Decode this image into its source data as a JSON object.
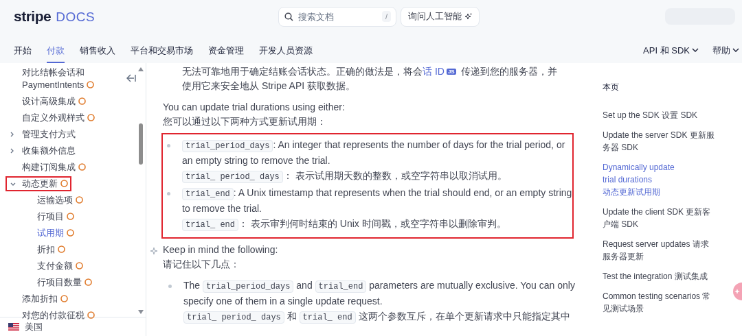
{
  "header": {
    "logo": {
      "wordmark": "stripe",
      "product": "DOCS"
    },
    "search": {
      "placeholder": "搜索文档",
      "shortcut": "/"
    },
    "ask_ai": {
      "label": "询问人工智能"
    },
    "nav": [
      {
        "label": "开始",
        "selected": false
      },
      {
        "label": "付款",
        "selected": true
      },
      {
        "label": "销售收入",
        "selected": false
      },
      {
        "label": "平台和交易市场",
        "selected": false
      },
      {
        "label": "资金管理",
        "selected": false
      },
      {
        "label": "开发人员资源",
        "selected": false
      }
    ],
    "menus": [
      "API 和 SDK",
      "帮助"
    ]
  },
  "sidebar": {
    "items": [
      {
        "label": "对比结帐会话和 PaymentIntents",
        "kind": "link",
        "marked": true,
        "selected": false
      },
      {
        "label": "设计高级集成",
        "kind": "link",
        "marked": true,
        "selected": false
      },
      {
        "label": "自定义外观样式",
        "kind": "link",
        "marked": true,
        "selected": false
      },
      {
        "label": "管理支付方式",
        "kind": "group",
        "expanded": false,
        "marked": false,
        "selected": false
      },
      {
        "label": "收集额外信息",
        "kind": "group",
        "expanded": false,
        "marked": false,
        "selected": false
      },
      {
        "label": "构建订阅集成",
        "kind": "link",
        "marked": true,
        "selected": false
      },
      {
        "label": "动态更新",
        "kind": "group",
        "expanded": true,
        "marked": true,
        "selected": false,
        "highlighted": true,
        "children": [
          {
            "label": "运输选项",
            "kind": "link",
            "marked": true,
            "selected": false
          },
          {
            "label": "行项目",
            "kind": "link",
            "marked": true,
            "selected": false
          },
          {
            "label": "试用期",
            "kind": "link",
            "marked": true,
            "selected": true
          },
          {
            "label": "折扣",
            "kind": "link",
            "marked": true,
            "selected": false
          },
          {
            "label": "支付金额",
            "kind": "link",
            "marked": true,
            "selected": false
          },
          {
            "label": "行项目数量",
            "kind": "link",
            "marked": true,
            "selected": false
          }
        ]
      },
      {
        "label": "添加折扣",
        "kind": "link",
        "marked": true,
        "selected": false
      },
      {
        "label": "对您的付款征税",
        "kind": "link",
        "marked": true,
        "selected": false
      }
    ],
    "footer": {
      "label": "美国"
    }
  },
  "main": {
    "blocks": [
      {
        "kind": "paragraph",
        "indent": true,
        "lines": [
          [
            {
              "kind": "text",
              "text": "无法可靠地用于确定结账会话状态。正确的做法是，将会"
            },
            {
              "kind": "link",
              "text": "话 ID"
            },
            {
              "kind": "badge",
              "text": "JS"
            },
            {
              "kind": "text",
              "text": " 传递到您的服务器，并"
            }
          ],
          [
            {
              "kind": "text",
              "text": "使用它来安全地从 Stripe API 获取数据。"
            }
          ]
        ]
      },
      {
        "kind": "paragraph",
        "indent": false,
        "lines": [
          [
            {
              "kind": "text",
              "text": "You can update trial durations using either:"
            }
          ],
          [
            {
              "kind": "text",
              "text": "您可以通过以下两种方式更新试用期："
            }
          ]
        ]
      },
      {
        "kind": "list",
        "highlighted": true,
        "items": [
          {
            "en": [
              {
                "kind": "code",
                "text": "trial_period_days"
              },
              {
                "kind": "text",
                "text": ": An integer that represents the number of days for the trial period, or an empty string to remove the trial."
              }
            ],
            "zh": [
              {
                "kind": "code",
                "text": "trial_ period_ days"
              },
              {
                "kind": "text",
                "text": "： 表示试用期天数的整数，或空字符串以取消试用。"
              }
            ]
          },
          {
            "en": [
              {
                "kind": "code",
                "text": "trial_end"
              },
              {
                "kind": "text",
                "text": ": A Unix timestamp that represents when the trial should end, or an empty string to remove the trial."
              }
            ],
            "zh": [
              {
                "kind": "code",
                "text": "trial_ end"
              },
              {
                "kind": "text",
                "text": "： 表示审判何时结束的 Unix 时间戳，或空字符串以删除审判。"
              }
            ]
          }
        ]
      },
      {
        "kind": "paragraph",
        "indent": false,
        "sparkle": true,
        "lines": [
          [
            {
              "kind": "text",
              "text": "Keep in mind the following:"
            }
          ],
          [
            {
              "kind": "text",
              "text": "请记住以下几点："
            }
          ]
        ]
      },
      {
        "kind": "list",
        "highlighted": false,
        "items": [
          {
            "en": [
              {
                "kind": "text",
                "text": "The "
              },
              {
                "kind": "code",
                "text": "trial_period_days"
              },
              {
                "kind": "text",
                "text": " and "
              },
              {
                "kind": "code",
                "text": "trial_end"
              },
              {
                "kind": "text",
                "text": " parameters are mutually exclusive. You can only specify one of them in a single update request."
              }
            ],
            "zh": [
              {
                "kind": "code",
                "text": "trial_ period_ days"
              },
              {
                "kind": "text",
                "text": " 和 "
              },
              {
                "kind": "code",
                "text": "trial_ end"
              },
              {
                "kind": "text",
                "text": " 这两个参数互斥，在单个更新请求中只能指定其中"
              }
            ]
          }
        ]
      }
    ]
  },
  "toc": {
    "title": "本页",
    "items": [
      {
        "label": "Set up the SDK  设置 SDK",
        "selected": false
      },
      {
        "label": "Update the server SDK  更新服务器 SDK",
        "selected": false
      },
      {
        "label": "Dynamically update trial durations 动态更新试用期",
        "selected": true
      },
      {
        "label": "Update the client SDK  更新客户端 SDK",
        "selected": false
      },
      {
        "label": "Request server updates  请求服务器更新",
        "selected": false
      },
      {
        "label": "Test the integration  测试集成",
        "selected": false
      },
      {
        "label": "Common testing scenarios  常见测试场景",
        "selected": false
      }
    ]
  }
}
